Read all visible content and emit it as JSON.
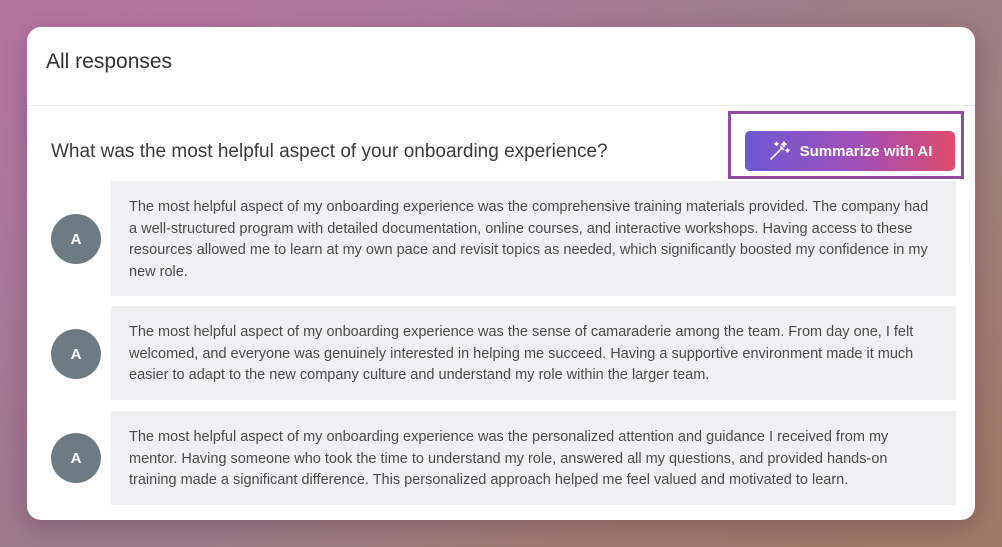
{
  "header": {
    "title": "All responses"
  },
  "question": {
    "text": "What was the most helpful aspect of your onboarding experience?"
  },
  "summarize_button": {
    "label": "Summarize with AI",
    "icon": "magic-wand-icon"
  },
  "colors": {
    "button_gradient_start": "#6d58d4",
    "button_gradient_end": "#e04b6c",
    "highlight_border": "#8e4d9f",
    "avatar_bg": "#6f7b83",
    "bubble_bg": "#f0eff2"
  },
  "responses": [
    {
      "avatar_initial": "A",
      "text": "The most helpful aspect of my onboarding experience was the comprehensive training materials provided. The company had a well-structured program with detailed documentation, online courses, and interactive workshops. Having access to these resources allowed me to learn at my own pace and revisit topics as needed, which significantly boosted my confidence in my new role."
    },
    {
      "avatar_initial": "A",
      "text": "The most helpful aspect of my onboarding experience was the sense of camaraderie among the team. From day one, I felt welcomed, and everyone was genuinely interested in helping me succeed. Having a supportive environment made it much easier to adapt to the new company culture and understand my role within the larger team."
    },
    {
      "avatar_initial": "A",
      "text": "The most helpful aspect of my onboarding experience was the personalized attention and guidance I received from my mentor. Having someone who took the time to understand my role, answered all my questions, and provided hands-on training made a significant difference. This personalized approach helped me feel valued and motivated to learn."
    }
  ]
}
